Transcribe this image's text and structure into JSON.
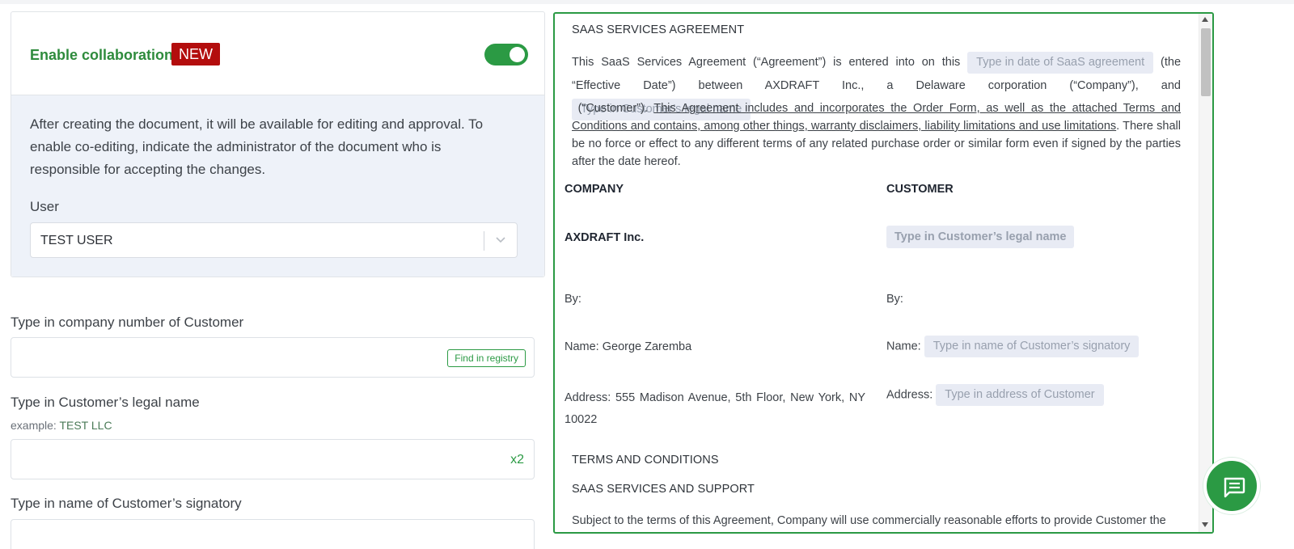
{
  "collaboration": {
    "title": "Enable collaboration",
    "badge": "NEW",
    "toggle_on": true,
    "description": "After creating the document, it will be available for editing and approval. To enable co-editing, indicate the administrator of the document who is responsible for accepting the changes.",
    "user_label": "User",
    "user_value": "TEST USER"
  },
  "fields": {
    "company_number": {
      "label": "Type in company number of Customer",
      "button": "Find in registry"
    },
    "legal_name": {
      "label": "Type in Customer’s legal name",
      "example_prefix": "example: ",
      "example_value": "TEST LLC",
      "counter": "x2"
    },
    "signatory": {
      "label": "Type in name of Customer’s signatory"
    }
  },
  "document": {
    "title": "SAAS SERVICES AGREEMENT",
    "intro_1": "This SaaS Services Agreement (“Agreement”) is entered into on this",
    "ph_date": "Type in date of SaaS agreement",
    "intro_2": "(the “Effective Date”) between AXDRAFT Inc., a Delaware corporation (“Company”), and",
    "ph_legal_name": "Type in Customer’s legal name",
    "intro_3": "(“Customer”).",
    "intro_underlined": "This Agreement includes and incorporates the Order Form, as well as the attached Terms and Conditions and contains, among other things, warranty disclaimers, liability limitations and use limitations",
    "intro_4": ". There shall be no force or effect to any different terms of any related purchase order or similar form even if signed by the parties after the date hereof.",
    "company_head": "COMPANY",
    "customer_head": "CUSTOMER",
    "company_name": "AXDRAFT Inc.",
    "ph_customer_name": "Type in Customer’s legal name",
    "by_label": "By:",
    "company_name_line": "Name: George Zaremba",
    "name_label": "Name:",
    "ph_signatory": "Type in name of Customer’s signatory",
    "company_address": "Address: 555 Madison Avenue, 5th Floor, New York, NY 10022",
    "address_label": "Address:",
    "ph_address": "Type in address of Customer",
    "terms_heading": "TERMS AND CONDITIONS",
    "support_heading": "SAAS SERVICES AND SUPPORT",
    "support_text": "Subject to the terms of this Agreement, Company will use commercially reasonable efforts to provide Customer the"
  },
  "colors": {
    "accent": "#2b9a44",
    "badge": "#b30d0d",
    "panel_bg": "#eef2f9",
    "placeholder_bg": "#e8ebf4"
  },
  "icons": {
    "chat": "chat-bubble-icon",
    "chevron": "chevron-down-icon"
  }
}
